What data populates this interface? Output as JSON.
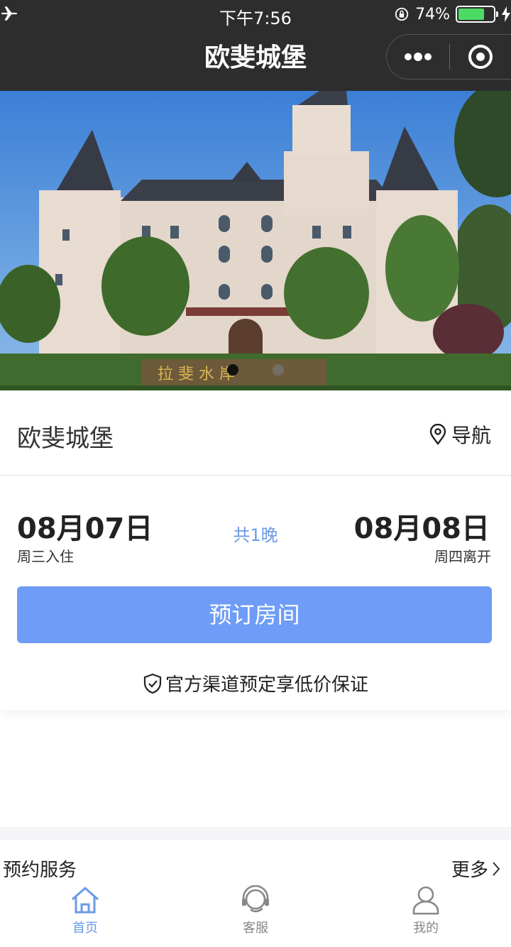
{
  "status_bar": {
    "time": "下午7:56",
    "battery_percent": "74%",
    "battery_level": 0.74
  },
  "nav": {
    "title": "欧斐城堡",
    "more_icon": "more-dots-icon",
    "close_icon": "target-close-icon"
  },
  "hero": {
    "slides": 2,
    "active_slide": 0,
    "sign_text": "拉 斐 水 岸"
  },
  "hotel": {
    "name": "欧斐城堡",
    "navigate_label": "导航"
  },
  "dates": {
    "checkin_date": "08月07日",
    "checkin_label": "周三入住",
    "nights": "共1晚",
    "checkout_date": "08月08日",
    "checkout_label": "周四离开"
  },
  "book_button": "预订房间",
  "guarantee_text": "官方渠道预定享低价保证",
  "services": {
    "title": "预约服务",
    "more_label": "更多"
  },
  "tabs": [
    {
      "label": "首页",
      "icon": "home-icon",
      "active": true
    },
    {
      "label": "客服",
      "icon": "headset-icon",
      "active": false
    },
    {
      "label": "我的",
      "icon": "user-icon",
      "active": false
    }
  ],
  "colors": {
    "accent": "#6e9cf7",
    "tab_active": "#6b9ae6",
    "header": "#2d2d2d",
    "battery": "#4cd964"
  }
}
